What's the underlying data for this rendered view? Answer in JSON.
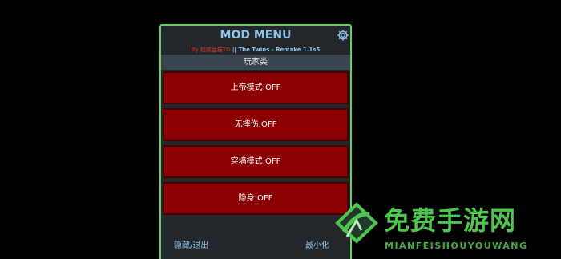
{
  "menu": {
    "title": "MOD MENU",
    "subtitle_author": "By 超威蓝猫TD",
    "subtitle_game": " || The Twins - Remake 1.1s5",
    "category": "玩家类",
    "items": [
      {
        "label": "上帝模式:OFF"
      },
      {
        "label": "无摔伤:OFF"
      },
      {
        "label": "穿墙模式:OFF"
      },
      {
        "label": "隐身:OFF"
      }
    ],
    "footer": {
      "hide_exit": "隐藏/退出",
      "minimize": "最小化"
    }
  },
  "watermark": {
    "cn_text": "免费手游网",
    "en_text": "MIANFEISHOUYOUWANG"
  },
  "colors": {
    "accent_border": "#5fd35f",
    "panel_bg": "#22272c",
    "item_bg": "#8b0000",
    "title": "#8fc4ea",
    "author": "#e0332c"
  }
}
